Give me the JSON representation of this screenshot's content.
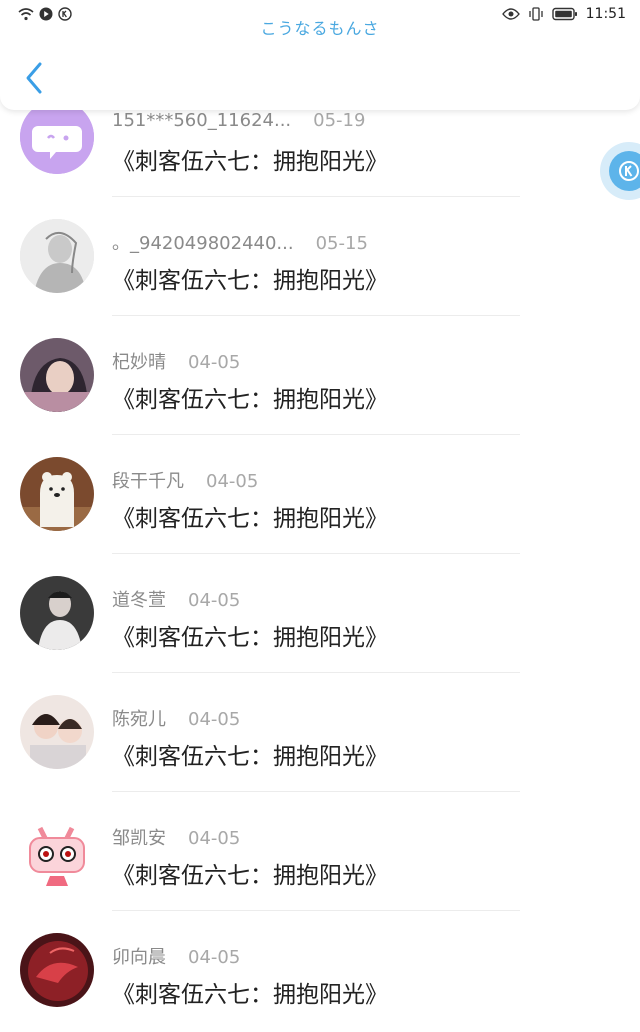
{
  "status_bar": {
    "time": "11:51"
  },
  "header": {
    "app_title": "こうなるもんさ"
  },
  "items": [
    {
      "name": "151***560_11624...",
      "date": "05-19",
      "content": "《刺客伍六七：拥抱阳光》",
      "avatar_color": "#c8a4ef"
    },
    {
      "name": "。_942049802440...",
      "date": "05-15",
      "content": "《刺客伍六七：拥抱阳光》",
      "avatar_color": "#d9d9d9"
    },
    {
      "name": "杞妙晴",
      "date": "04-05",
      "content": "《刺客伍六七：拥抱阳光》",
      "avatar_color": "#6d5a6a"
    },
    {
      "name": "段干千凡",
      "date": "04-05",
      "content": "《刺客伍六七：拥抱阳光》",
      "avatar_color": "#7b4a2e"
    },
    {
      "name": "道冬萱",
      "date": "04-05",
      "content": "《刺客伍六七：拥抱阳光》",
      "avatar_color": "#3a3a3a"
    },
    {
      "name": "陈宛儿",
      "date": "04-05",
      "content": "《刺客伍六七：拥抱阳光》",
      "avatar_color": "#e8d8d0"
    },
    {
      "name": "邹凯安",
      "date": "04-05",
      "content": "《刺客伍六七：拥抱阳光》",
      "avatar_color": "#f3c9cf"
    },
    {
      "name": "卯向晨",
      "date": "04-05",
      "content": "《刺客伍六七：拥抱阳光》",
      "avatar_color": "#7a1d22"
    }
  ]
}
